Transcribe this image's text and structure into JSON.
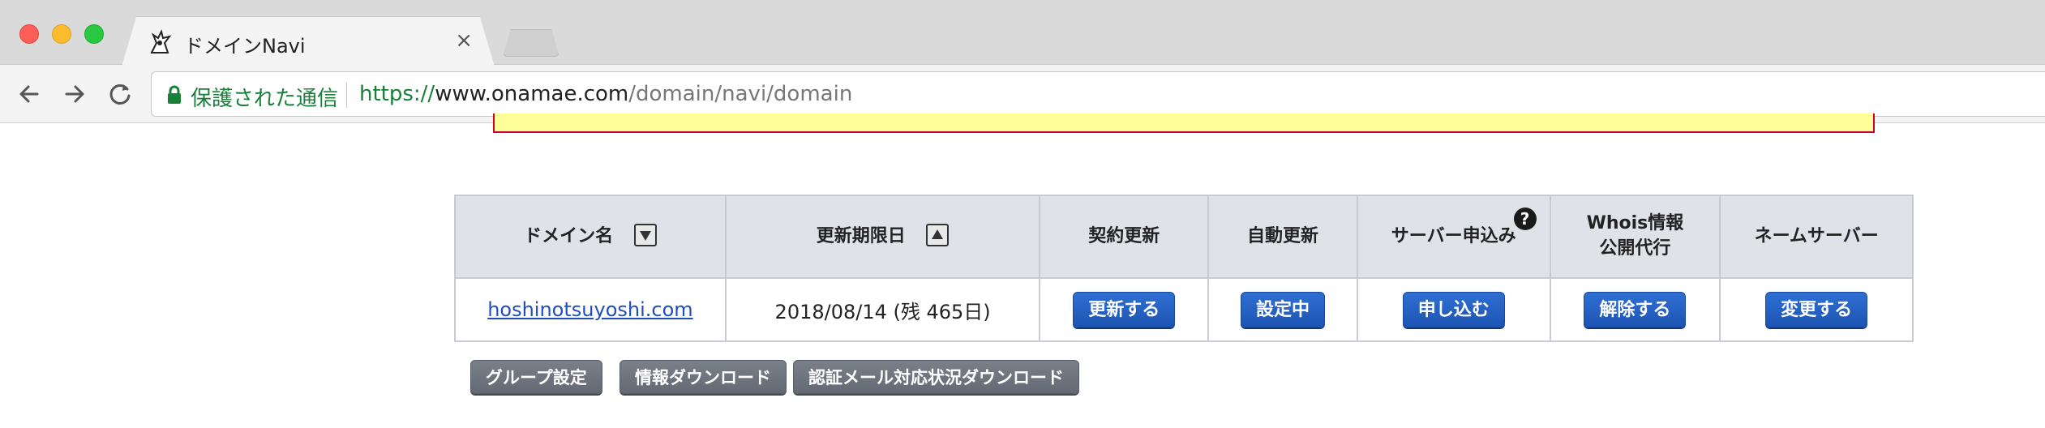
{
  "browser": {
    "tab_title": "ドメインNavi",
    "tab_close": "×",
    "secure_label": "保護された通信",
    "url_scheme": "https://",
    "url_host": "www.onamae.com",
    "url_path": "/domain/navi/domain"
  },
  "table": {
    "headers": {
      "domain": "ドメイン名",
      "expiry": "更新期限日",
      "renew": "契約更新",
      "auto_renew": "自動更新",
      "server": "サーバー申込み",
      "whois_line1": "Whois情報",
      "whois_line2": "公開代行",
      "nameserver": "ネームサーバー"
    },
    "sort_icons": {
      "domain": "sort-desc-icon",
      "expiry": "sort-asc-icon"
    },
    "help_icon_text": "?",
    "rows": [
      {
        "domain": "hoshinotsuyoshi.com",
        "expiry": "2018/08/14 (残 465日)",
        "renew_button": "更新する",
        "auto_renew_button": "設定中",
        "server_button": "申し込む",
        "whois_button": "解除する",
        "nameserver_button": "変更する"
      }
    ]
  },
  "actions": {
    "group_settings": "グループ設定",
    "info_download": "情報ダウンロード",
    "auth_mail_download": "認証メール対応状況ダウンロード"
  },
  "colors": {
    "primary_button": "#1d55b3",
    "secondary_button": "#646a74",
    "link": "#1f4fbf",
    "secure_green": "#188038",
    "notice_background": "#ffff99",
    "notice_border": "#cc0033"
  }
}
